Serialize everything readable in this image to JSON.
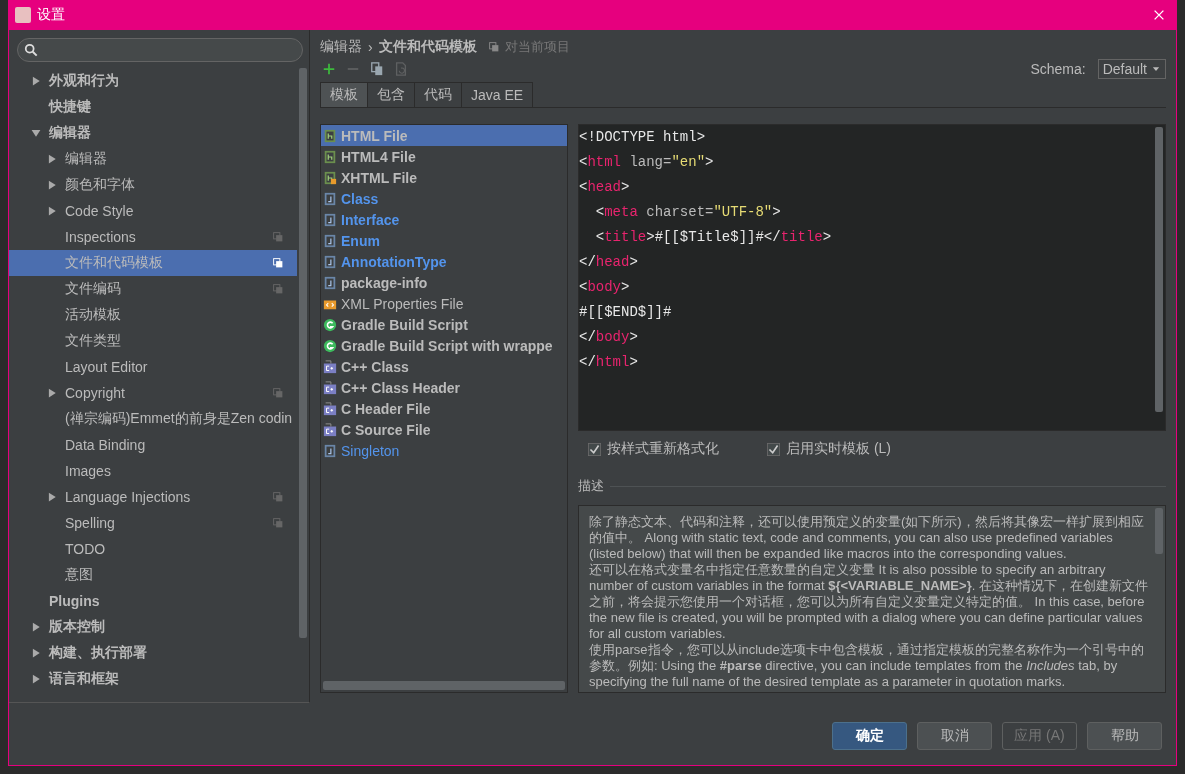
{
  "window": {
    "title": "设置"
  },
  "sidebar": {
    "items": [
      {
        "label": "外观和行为",
        "expanded": false,
        "selected": false
      },
      {
        "label": "快捷键",
        "selected": false
      },
      {
        "label": "编辑器",
        "expanded": true,
        "selected": false,
        "children": [
          {
            "label": "编辑器",
            "expanded": false,
            "selected": false
          },
          {
            "label": "颜色和字体",
            "expanded": false,
            "selected": false
          },
          {
            "label": "Code Style",
            "expanded": false,
            "selected": false
          },
          {
            "label": "Inspections",
            "selected": false,
            "project_scope": true
          },
          {
            "label": "文件和代码模板",
            "selected": true,
            "project_scope": true
          },
          {
            "label": "文件编码",
            "selected": false,
            "project_scope": true
          },
          {
            "label": "活动模板",
            "selected": false
          },
          {
            "label": "文件类型",
            "selected": false
          },
          {
            "label": "Layout Editor",
            "selected": false
          },
          {
            "label": "Copyright",
            "expanded": false,
            "selected": false,
            "project_scope": true
          },
          {
            "label": "(禅宗编码)Emmet的前身是Zen codin",
            "selected": false
          },
          {
            "label": "Data Binding",
            "selected": false
          },
          {
            "label": "Images",
            "selected": false
          },
          {
            "label": "Language Injections",
            "expanded": false,
            "selected": false,
            "project_scope": true
          },
          {
            "label": "Spelling",
            "selected": false,
            "project_scope": true
          },
          {
            "label": "TODO",
            "selected": false
          },
          {
            "label": "意图",
            "selected": false
          }
        ]
      },
      {
        "label": "Plugins",
        "selected": false
      },
      {
        "label": "版本控制",
        "expanded": false,
        "selected": false
      },
      {
        "label": "构建、执行部署",
        "expanded": false,
        "selected": false
      },
      {
        "label": "语言和框架",
        "expanded": false,
        "selected": false
      }
    ]
  },
  "breadcrumb": {
    "parent": "编辑器",
    "separator": "›",
    "current": "文件和代码模板",
    "scope": "对当前项目"
  },
  "toolbar": {
    "buttons": [
      {
        "kind": "add",
        "disabled": false
      },
      {
        "kind": "remove",
        "disabled": true
      },
      {
        "kind": "copy",
        "disabled": false
      },
      {
        "kind": "reset",
        "disabled": true
      }
    ]
  },
  "schema": {
    "label": "Schema:",
    "value": "Default"
  },
  "tabs": [
    {
      "label": "模板",
      "selected": true
    },
    {
      "label": "包含",
      "selected": false
    },
    {
      "label": "代码",
      "selected": false
    },
    {
      "label": "Java EE",
      "selected": false
    }
  ],
  "templates": [
    {
      "name": "HTML File",
      "kind": "html",
      "bold": true,
      "color": "#bbbbbb",
      "selected": true
    },
    {
      "name": "HTML4 File",
      "kind": "html",
      "bold": true,
      "color": "#bbbbbb",
      "selected": false
    },
    {
      "name": "XHTML File",
      "kind": "xhtml",
      "bold": true,
      "color": "#bbbbbb",
      "selected": false
    },
    {
      "name": "Class",
      "kind": "java",
      "bold": true,
      "color": "#5394ec",
      "selected": false
    },
    {
      "name": "Interface",
      "kind": "java",
      "bold": true,
      "color": "#5394ec",
      "selected": false
    },
    {
      "name": "Enum",
      "kind": "java",
      "bold": true,
      "color": "#5394ec",
      "selected": false
    },
    {
      "name": "AnnotationType",
      "kind": "java",
      "bold": true,
      "color": "#5394ec",
      "selected": false
    },
    {
      "name": "package-info",
      "kind": "java",
      "bold": true,
      "color": "#bbbbbb",
      "selected": false
    },
    {
      "name": "XML Properties File",
      "kind": "xml",
      "bold": false,
      "color": "#bbbbbb",
      "selected": false
    },
    {
      "name": "Gradle Build Script",
      "kind": "gradle",
      "bold": true,
      "color": "#bbbbbb",
      "selected": false
    },
    {
      "name": "Gradle Build Script with wrappe",
      "kind": "gradle",
      "bold": true,
      "color": "#bbbbbb",
      "selected": false
    },
    {
      "name": "C++ Class",
      "kind": "cpp",
      "bold": true,
      "color": "#bbbbbb",
      "selected": false
    },
    {
      "name": "C++ Class Header",
      "kind": "cpp",
      "bold": true,
      "color": "#bbbbbb",
      "selected": false
    },
    {
      "name": "C Header File",
      "kind": "cpp",
      "bold": true,
      "color": "#bbbbbb",
      "selected": false
    },
    {
      "name": "C Source File",
      "kind": "cpp",
      "bold": true,
      "color": "#bbbbbb",
      "selected": false
    },
    {
      "name": "Singleton",
      "kind": "java",
      "bold": false,
      "color": "#5394ec",
      "selected": false
    }
  ],
  "editor": {
    "lines": [
      [
        {
          "kind": "punct",
          "text": "<"
        },
        {
          "kind": "plain",
          "text": "!DOCTYPE html"
        },
        {
          "kind": "punct",
          "text": ">"
        }
      ],
      [
        {
          "kind": "punct",
          "text": "<"
        },
        {
          "kind": "tag",
          "text": "html"
        },
        {
          "kind": "attr",
          "text": " lang="
        },
        {
          "kind": "string",
          "text": "\"en\""
        },
        {
          "kind": "punct",
          "text": ">"
        }
      ],
      [
        {
          "kind": "punct",
          "text": "<"
        },
        {
          "kind": "tag",
          "text": "head"
        },
        {
          "kind": "punct",
          "text": ">"
        }
      ],
      [
        {
          "kind": "punct",
          "text": "  <"
        },
        {
          "kind": "tag",
          "text": "meta"
        },
        {
          "kind": "attr",
          "text": " charset="
        },
        {
          "kind": "string",
          "text": "\"UTF-8\""
        },
        {
          "kind": "punct",
          "text": ">"
        }
      ],
      [
        {
          "kind": "punct",
          "text": "  <"
        },
        {
          "kind": "tag",
          "text": "title"
        },
        {
          "kind": "punct",
          "text": ">"
        },
        {
          "kind": "plain",
          "text": "#[[$Title$]]#"
        },
        {
          "kind": "punct",
          "text": "</"
        },
        {
          "kind": "tag",
          "text": "title"
        },
        {
          "kind": "punct",
          "text": ">"
        }
      ],
      [
        {
          "kind": "punct",
          "text": "</"
        },
        {
          "kind": "tag",
          "text": "head"
        },
        {
          "kind": "punct",
          "text": ">"
        }
      ],
      [
        {
          "kind": "punct",
          "text": "<"
        },
        {
          "kind": "tag",
          "text": "body"
        },
        {
          "kind": "punct",
          "text": ">"
        }
      ],
      [
        {
          "kind": "plain",
          "text": "#[[$END$]]#"
        }
      ],
      [
        {
          "kind": "punct",
          "text": "</"
        },
        {
          "kind": "tag",
          "text": "body"
        },
        {
          "kind": "punct",
          "text": ">"
        }
      ],
      [
        {
          "kind": "punct",
          "text": "</"
        },
        {
          "kind": "tag",
          "text": "html"
        },
        {
          "kind": "punct",
          "text": ">"
        }
      ]
    ]
  },
  "options": [
    {
      "label": "按样式重新格式化",
      "checked": true
    },
    {
      "label": "启用实时模板 (L)",
      "checked": true
    }
  ],
  "description": {
    "title": "描述",
    "paragraphs": [
      "除了静态文本、代码和注释，还可以使用预定义的变量(如下所示)，然后将其像宏一样扩展到相应的值中。 Along with static text, code and comments, you can also use predefined variables (listed below) that will then be expanded like macros into the corresponding values.",
      "还可以在格式变量名中指定任意数量的自定义变量 It is also possible to specify an arbitrary number of custom variables in the format **${<VARIABLE_NAME>}**. 在这种情况下，在创建新文件之前，将会提示您使用一个对话框，您可以为所有自定义变量定义特定的值。 In this case, before the new file is created, you will be prompted with a dialog where you can define particular values for all custom variables.",
      "使用parse指令，您可以从include选项卡中包含模板，通过指定模板的完整名称作为一个引号中的参数。例如: Using the **#parse** directive, you can include templates from the *Includes* tab, by specifying the full name of the desired template as a parameter in quotation marks."
    ]
  },
  "buttons": [
    {
      "label": "确定",
      "kind": "primary",
      "disabled": false
    },
    {
      "label": "取消",
      "kind": "normal",
      "disabled": false
    },
    {
      "label": "应用 (A)",
      "kind": "normal",
      "disabled": true
    },
    {
      "label": "帮助",
      "kind": "normal",
      "disabled": false
    }
  ]
}
